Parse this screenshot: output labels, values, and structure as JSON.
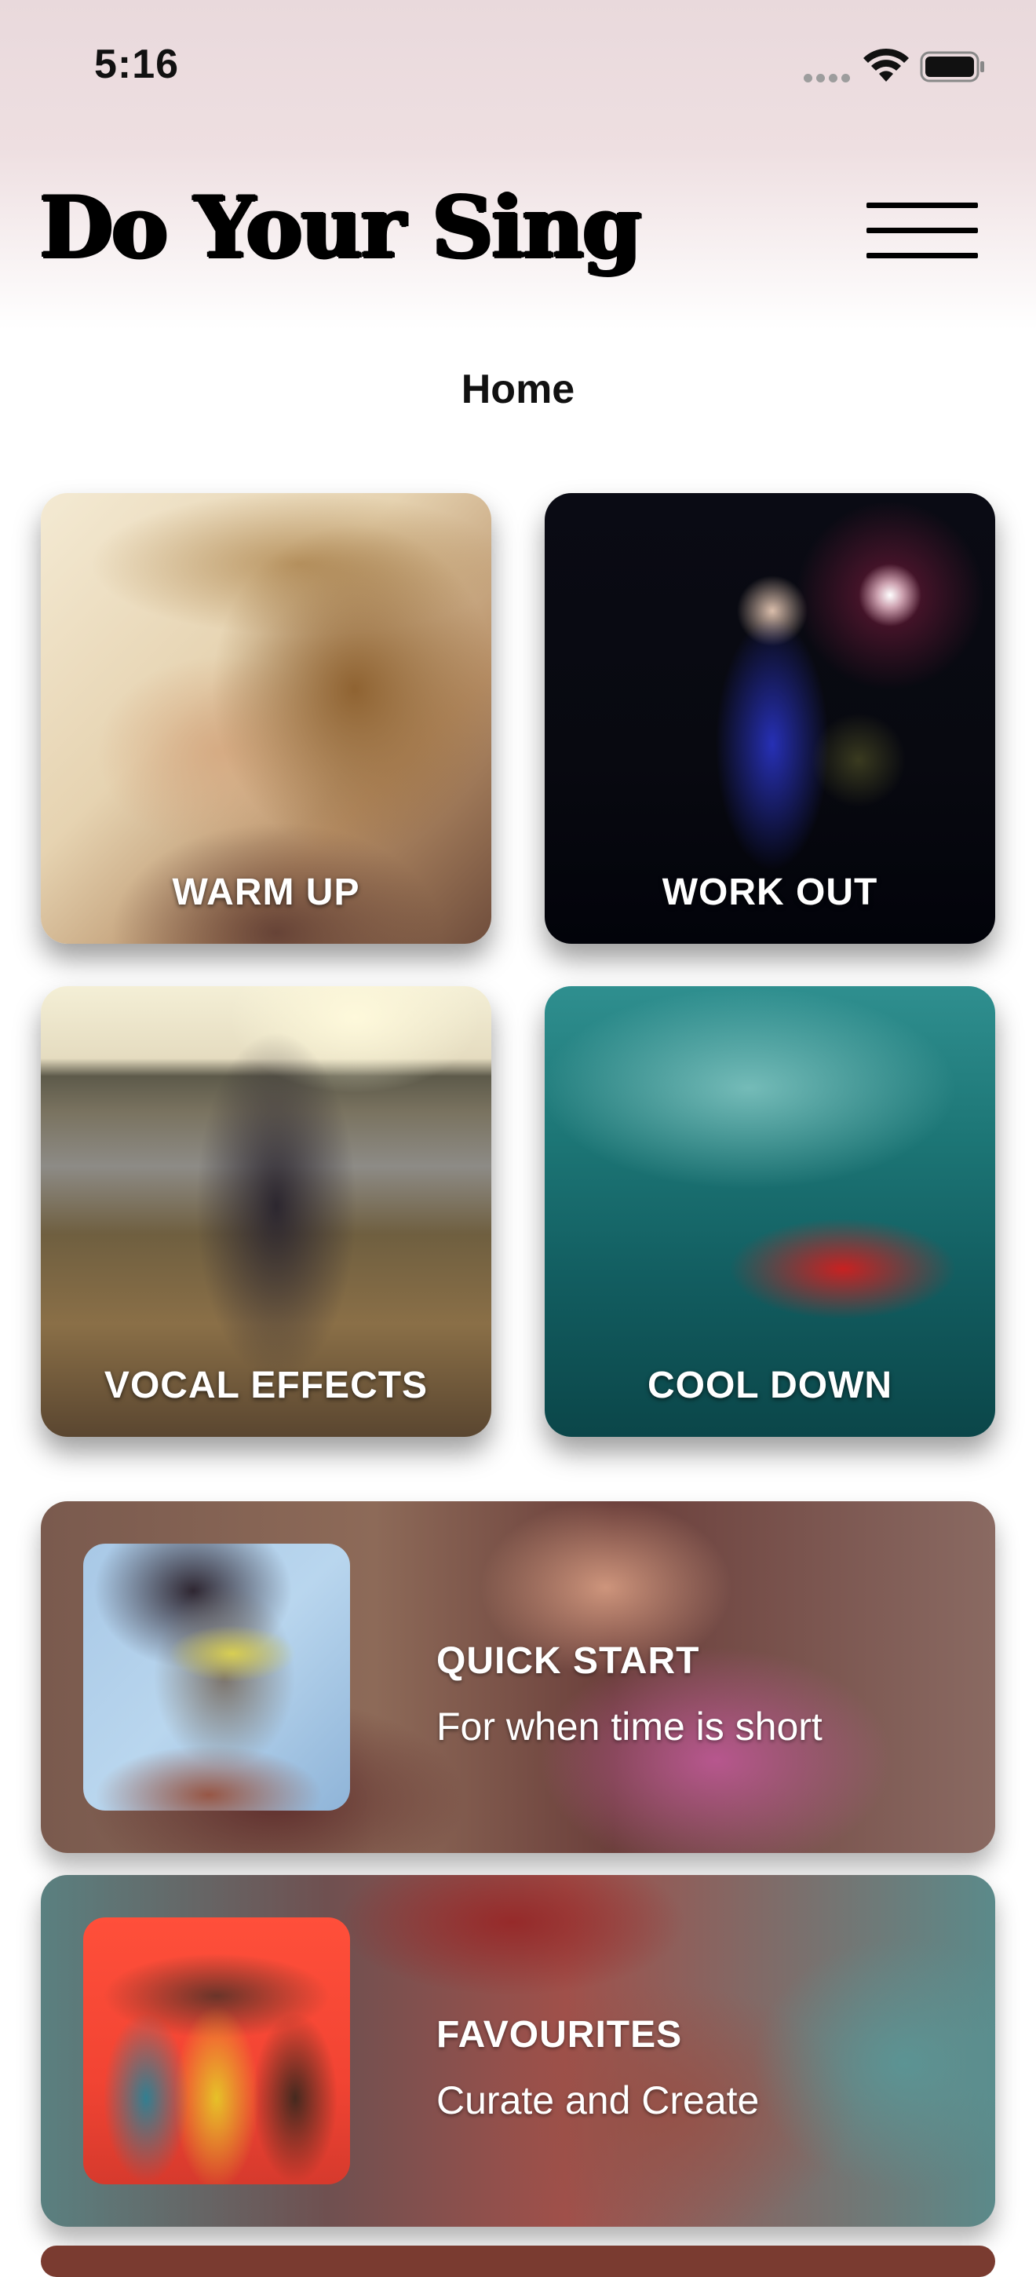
{
  "status_bar": {
    "time": "5:16",
    "signal_icon": "cellular-dots-icon",
    "wifi_icon": "wifi-icon",
    "battery_icon": "battery-icon"
  },
  "header": {
    "app_title": "Do Your Sing",
    "menu_icon": "hamburger-menu-icon"
  },
  "page": {
    "title": "Home"
  },
  "tiles": [
    {
      "label": "WARM UP"
    },
    {
      "label": "WORK OUT"
    },
    {
      "label": "VOCAL EFFECTS"
    },
    {
      "label": "COOL DOWN"
    }
  ],
  "banners": [
    {
      "title": "QUICK START",
      "subtitle": "For when time is short"
    },
    {
      "title": "FAVOURITES",
      "subtitle": "Curate and Create"
    }
  ],
  "colors": {
    "header_tint": "#e9d9dc",
    "text_primary": "#000000",
    "label_text": "#ffffff"
  }
}
